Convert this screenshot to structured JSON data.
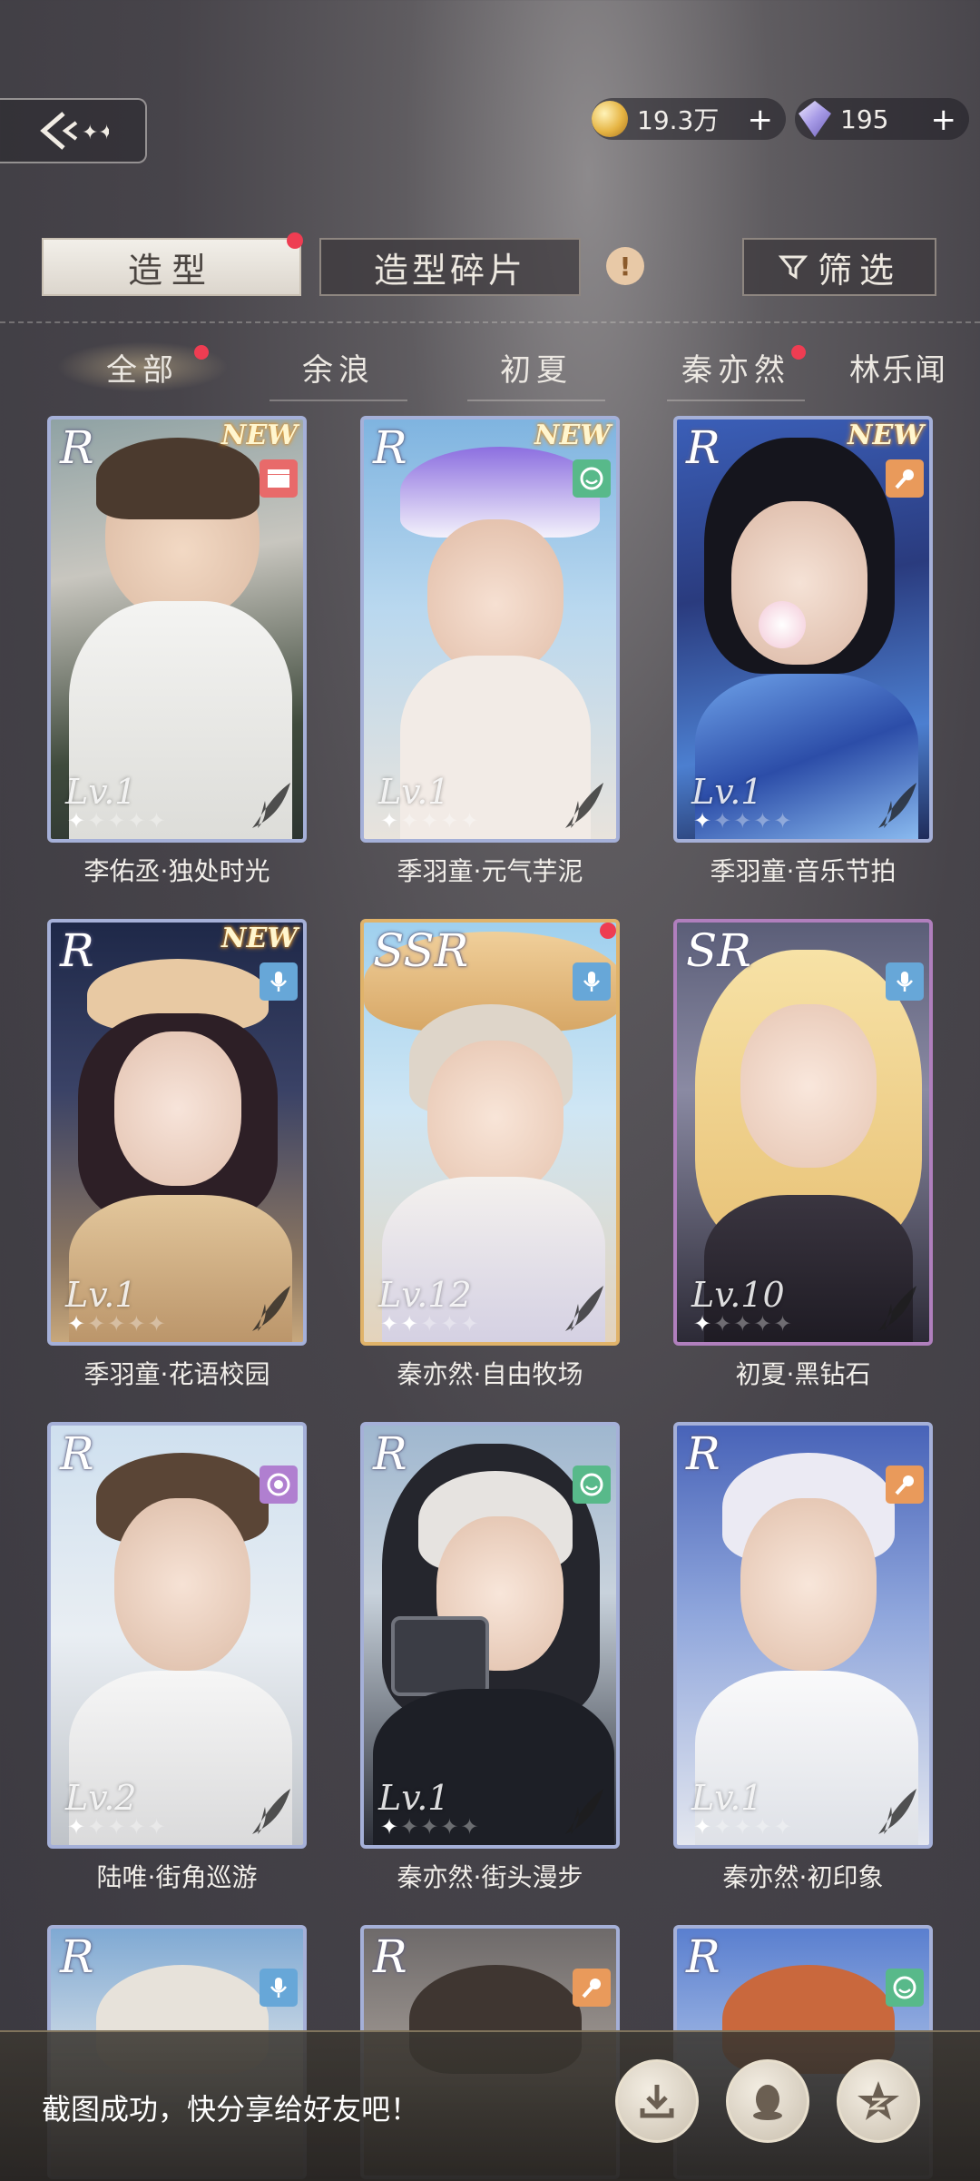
{
  "header": {
    "coins": "19.3万",
    "gems": "195",
    "plus": "+"
  },
  "tabs": {
    "outfit": "造型",
    "fragments": "造型碎片",
    "info": "!",
    "filter": "筛选"
  },
  "characters": [
    "全部",
    "余浪",
    "初夏",
    "秦亦然",
    "林乐闻"
  ],
  "cards": [
    {
      "rarity": "R",
      "new": "NEW",
      "level": "Lv.1",
      "name": "李佑丞·独处时光"
    },
    {
      "rarity": "R",
      "new": "NEW",
      "level": "Lv.1",
      "name": "季羽童·元气芋泥"
    },
    {
      "rarity": "R",
      "new": "NEW",
      "level": "Lv.1",
      "name": "季羽童·音乐节拍"
    },
    {
      "rarity": "R",
      "new": "NEW",
      "level": "Lv.1",
      "name": "季羽童·花语校园"
    },
    {
      "rarity": "SSR",
      "new": "",
      "level": "Lv.12",
      "name": "秦亦然·自由牧场"
    },
    {
      "rarity": "SR",
      "new": "",
      "level": "Lv.10",
      "name": "初夏·黑钻石"
    },
    {
      "rarity": "R",
      "new": "",
      "level": "Lv.2",
      "name": "陆唯·街角巡游"
    },
    {
      "rarity": "R",
      "new": "",
      "level": "Lv.1",
      "name": "秦亦然·街头漫步"
    },
    {
      "rarity": "R",
      "new": "",
      "level": "Lv.1",
      "name": "秦亦然·初印象"
    },
    {
      "rarity": "R",
      "new": "",
      "level": "",
      "name": ""
    },
    {
      "rarity": "R",
      "new": "",
      "level": "",
      "name": ""
    },
    {
      "rarity": "R",
      "new": "",
      "level": "",
      "name": ""
    }
  ],
  "toast": {
    "text": "截图成功，快分享给好友吧！"
  },
  "colors": {
    "accent_red": "#ee3d52",
    "frame_R": "#a5b0d8",
    "frame_SR": "#b07fbd",
    "frame_SSR": "#e0b36a"
  }
}
